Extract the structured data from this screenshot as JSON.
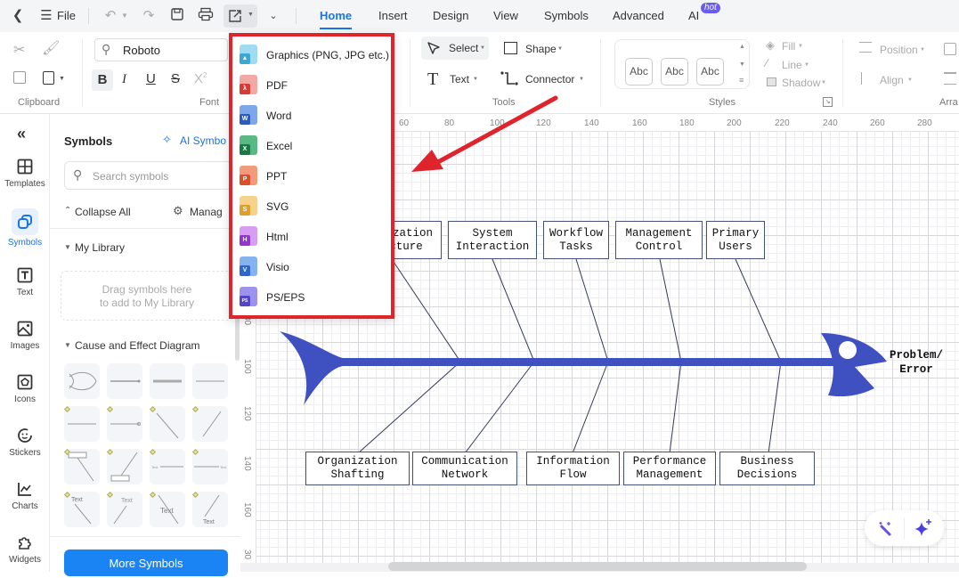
{
  "topbar": {
    "file_label": "File",
    "tabs": [
      {
        "label": "Home",
        "active": true
      },
      {
        "label": "Insert"
      },
      {
        "label": "Design"
      },
      {
        "label": "View"
      },
      {
        "label": "Symbols"
      },
      {
        "label": "Advanced"
      },
      {
        "label": "AI",
        "badge": "hot"
      }
    ]
  },
  "ribbon": {
    "clipboard_label": "Clipboard",
    "font_value": "Roboto",
    "font_label": "Font",
    "tools": {
      "select": "Select",
      "shape": "Shape",
      "text": "Text",
      "connector": "Connector",
      "label": "Tools"
    },
    "styles": {
      "swatches": [
        "Abc",
        "Abc",
        "Abc"
      ],
      "fill": "Fill",
      "line": "Line",
      "shadow": "Shadow",
      "label": "Styles"
    },
    "arrange": {
      "position": "Position",
      "align": "Align",
      "label": "Arra"
    }
  },
  "export_menu": {
    "items": [
      {
        "label": "Graphics (PNG, JPG etc.)",
        "color": "#4fb8e0",
        "tag": ""
      },
      {
        "label": "PDF",
        "color": "#e0433a",
        "tag": ""
      },
      {
        "label": "Word",
        "color": "#2f66cc",
        "tag": "W"
      },
      {
        "label": "Excel",
        "color": "#1f8a4c",
        "tag": "X"
      },
      {
        "label": "PPT",
        "color": "#e0552f",
        "tag": "P"
      },
      {
        "label": "SVG",
        "color": "#e8a92e",
        "tag": "S"
      },
      {
        "label": "Html",
        "color": "#9b3ad8",
        "tag": "H"
      },
      {
        "label": "Visio",
        "color": "#2c6fd8",
        "tag": "V"
      },
      {
        "label": "PS/EPS",
        "color": "#5b4ad0",
        "tag": "PS"
      }
    ]
  },
  "rail": {
    "items": [
      {
        "label": "Templates",
        "icon": "templates-icon"
      },
      {
        "label": "Symbols",
        "icon": "symbols-icon",
        "active": true
      },
      {
        "label": "Text",
        "icon": "text-icon"
      },
      {
        "label": "Images",
        "icon": "images-icon"
      },
      {
        "label": "Icons",
        "icon": "icons-icon"
      },
      {
        "label": "Stickers",
        "icon": "stickers-icon"
      },
      {
        "label": "Charts",
        "icon": "charts-icon"
      },
      {
        "label": "Widgets",
        "icon": "widgets-icon"
      }
    ]
  },
  "panel": {
    "title": "Symbols",
    "ai_symbols": "AI Symbo",
    "search_placeholder": "Search symbols",
    "collapse_all": "Collapse All",
    "manage": "Manag",
    "my_library": "My Library",
    "drop_hint_1": "Drag symbols here",
    "drop_hint_2": "to add to My Library",
    "cause_effect": "Cause and Effect Diagram",
    "more_symbols": "More Symbols"
  },
  "rulers": {
    "top": [
      "60",
      "80",
      "100",
      "120",
      "140",
      "160",
      "180",
      "200",
      "220",
      "240",
      "260",
      "280"
    ],
    "left": [
      "80",
      "100",
      "120",
      "140",
      "160",
      "30"
    ]
  },
  "diagram": {
    "problem": "Problem/\nError",
    "spine_color": "#3f51c0",
    "top_causes": [
      "Organization\nStructure",
      "System\nInteraction",
      "Workflow\nTasks",
      "Management\nControl",
      "Primary\nUsers"
    ],
    "bottom_causes": [
      "Organization\nShafting",
      "Communication\nNetwork",
      "Information\nFlow",
      "Performance\nManagement",
      "Business\nDecisions"
    ]
  }
}
